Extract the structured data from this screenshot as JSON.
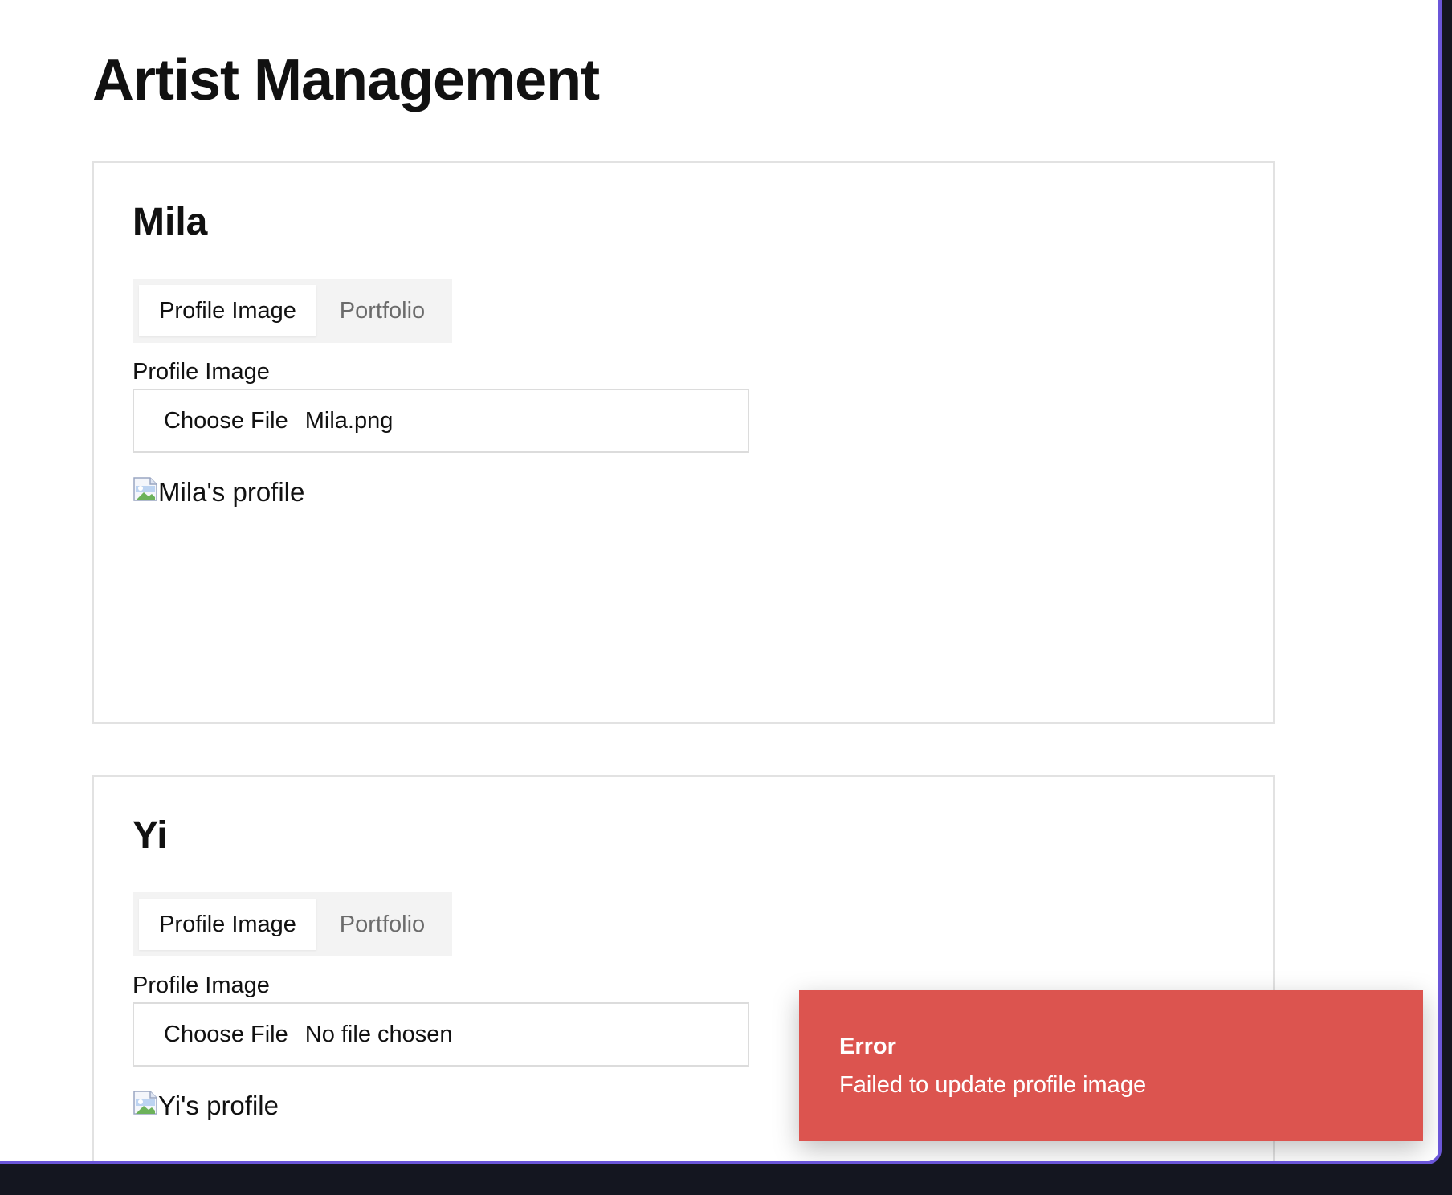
{
  "page": {
    "title": "Artist Management"
  },
  "artists": [
    {
      "name": "Mila",
      "tabs": [
        {
          "label": "Profile Image",
          "active": true
        },
        {
          "label": "Portfolio",
          "active": false
        }
      ],
      "field_label": "Profile Image",
      "file_input": {
        "button_label": "Choose File",
        "file_name": "Mila.png"
      },
      "image_alt": "Mila's profile"
    },
    {
      "name": "Yi",
      "tabs": [
        {
          "label": "Profile Image",
          "active": true
        },
        {
          "label": "Portfolio",
          "active": false
        }
      ],
      "field_label": "Profile Image",
      "file_input": {
        "button_label": "Choose File",
        "file_name": "No file chosen"
      },
      "image_alt": "Yi's profile"
    }
  ],
  "toast": {
    "title": "Error",
    "message": "Failed to update profile image",
    "color": "#dc544f"
  },
  "colors": {
    "accent_border": "#6b56d9"
  }
}
